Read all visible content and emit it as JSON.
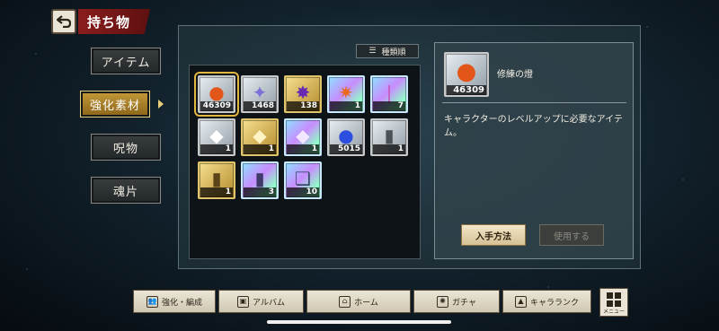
{
  "header": {
    "title": "持ち物"
  },
  "tabs": [
    {
      "label": "アイテム",
      "active": false
    },
    {
      "label": "強化素材",
      "active": true
    },
    {
      "label": "呪物",
      "active": false
    },
    {
      "label": "魂片",
      "active": false
    }
  ],
  "sort": {
    "label": "種類順",
    "icon": "list-sort-icon"
  },
  "items": [
    {
      "qty": "46309",
      "icon": "flame-orb-icon",
      "rarity": "silver",
      "selected": true
    },
    {
      "qty": "1468",
      "icon": "crystal-cluster-icon",
      "rarity": "silver"
    },
    {
      "qty": "138",
      "icon": "purple-crystal-icon",
      "rarity": "gold"
    },
    {
      "qty": "1",
      "icon": "burst-crystal-icon",
      "rarity": "rainbow"
    },
    {
      "qty": "7",
      "icon": "feather-shard-icon",
      "rarity": "rainbow"
    },
    {
      "qty": "1",
      "icon": "white-gem-icon",
      "rarity": "silver"
    },
    {
      "qty": "1",
      "icon": "gold-gem-icon",
      "rarity": "gold"
    },
    {
      "qty": "1",
      "icon": "rainbow-gem-icon",
      "rarity": "rainbow"
    },
    {
      "qty": "5015",
      "icon": "blue-orb-icon",
      "rarity": "silver"
    },
    {
      "qty": "1",
      "icon": "silver-card-icon",
      "rarity": "silver"
    },
    {
      "qty": "1",
      "icon": "gold-card-icon",
      "rarity": "gold"
    },
    {
      "qty": "3",
      "icon": "rainbow-card-icon",
      "rarity": "rainbow"
    },
    {
      "qty": "10",
      "icon": "stacked-cards-icon",
      "rarity": "rainbow"
    }
  ],
  "detail": {
    "qty": "46309",
    "name": "修練の燈",
    "description": "キャラクターのレベルアップに必要なアイテム。",
    "acquire_label": "入手方法",
    "use_label": "使用する"
  },
  "menu": [
    {
      "label": "強化・編成",
      "icon": "team-icon"
    },
    {
      "label": "アルバム",
      "icon": "album-icon"
    },
    {
      "label": "ホーム",
      "icon": "home-icon"
    },
    {
      "label": "ガチャ",
      "icon": "gacha-icon"
    },
    {
      "label": "キャラランク",
      "icon": "rank-icon"
    }
  ],
  "menu_grid_label": "メニュー",
  "colors": {
    "accent_red": "#8a1d1d",
    "tab_active_gold": "#c59a3a",
    "selection_gold": "#e2b73d"
  }
}
